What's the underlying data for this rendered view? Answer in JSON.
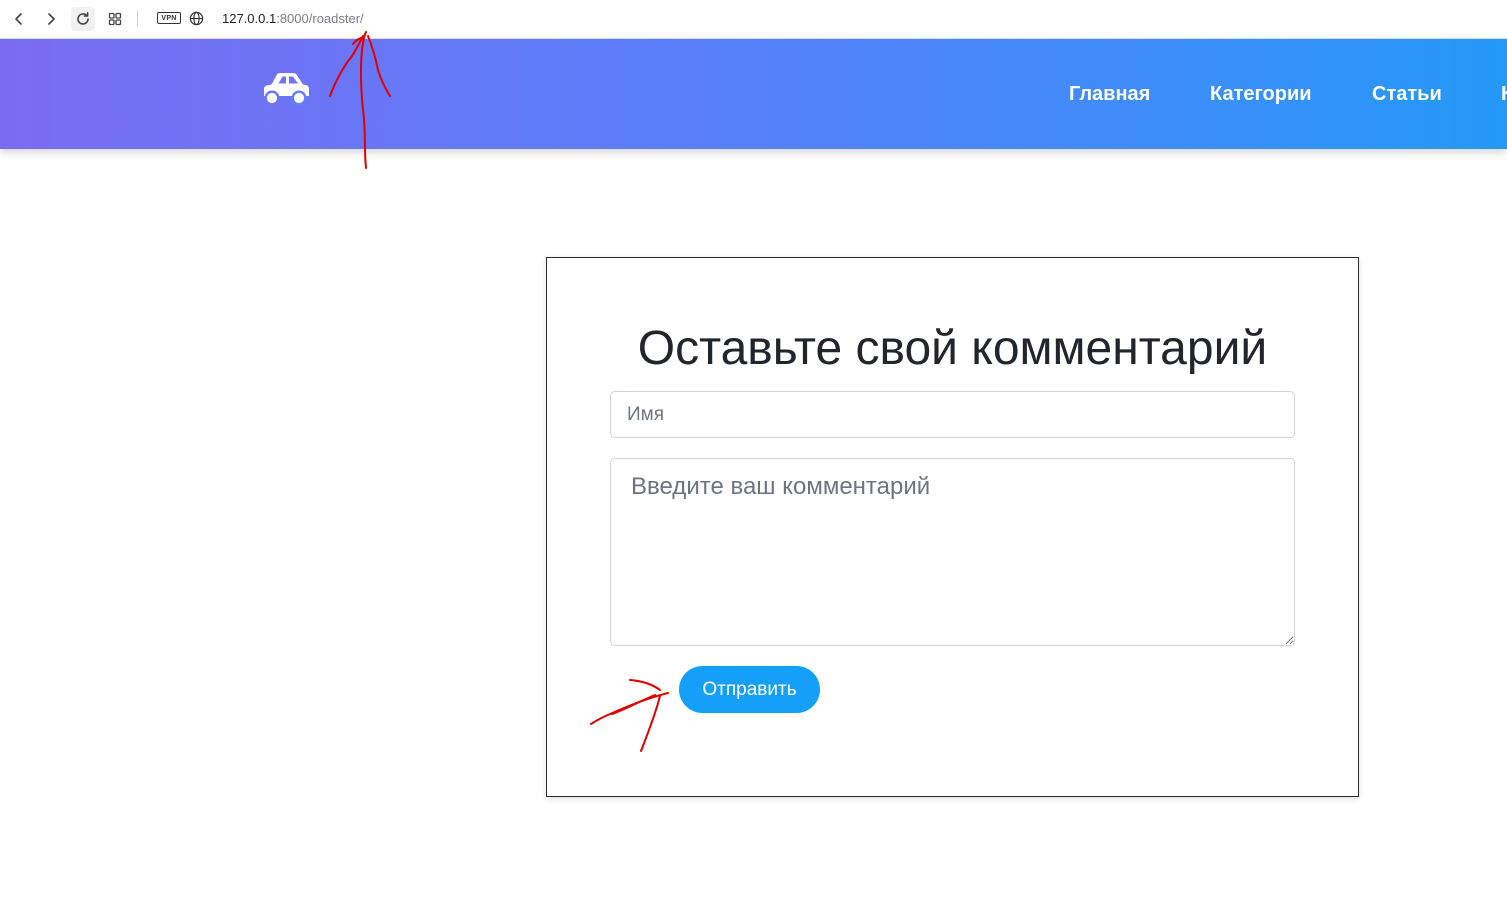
{
  "browser": {
    "url_host": "127.0.0.1",
    "url_rest": ":8000/roadster/",
    "vpn_badge": "VPN",
    "icons": [
      "back-arrow-icon",
      "forward-arrow-icon",
      "reload-icon",
      "tabs-grid-icon",
      "vpn-icon",
      "globe-icon"
    ]
  },
  "header": {
    "logo_icon": "car-icon",
    "nav": [
      {
        "label": "Главная"
      },
      {
        "label": "Категории"
      },
      {
        "label": "Статьи"
      },
      {
        "label": "К"
      }
    ],
    "gradient": [
      "#7a6cf2",
      "#2399f6"
    ]
  },
  "comment_form": {
    "title": "Оставьте свой комментарий",
    "name_placeholder": "Имя",
    "name_value": "",
    "comment_placeholder": "Введите ваш комментарий",
    "comment_value": "",
    "submit_label": "Отправить",
    "accent_color": "#14a0f8"
  },
  "annotations": {
    "color": "#e00000",
    "marks": [
      "arrow-to-url",
      "arrow-to-submit-button"
    ]
  }
}
